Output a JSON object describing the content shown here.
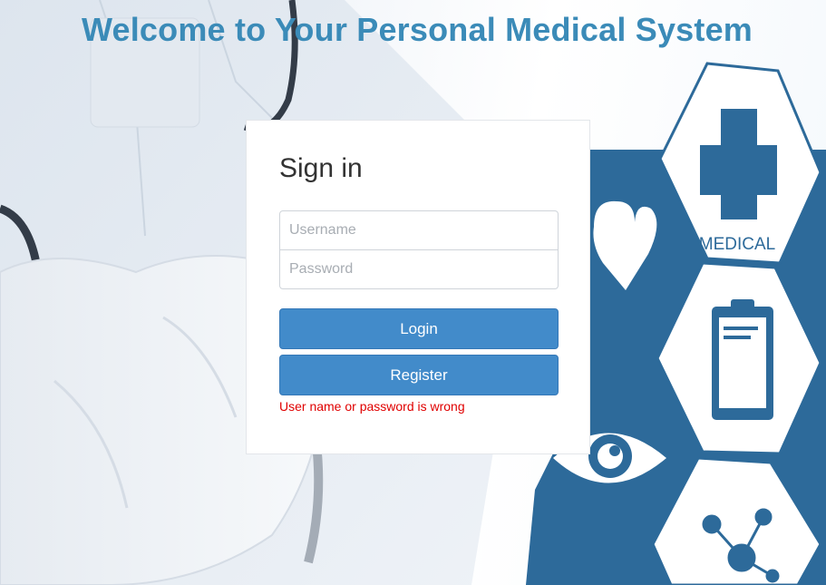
{
  "header": {
    "title": "Welcome to Your Personal Medical System"
  },
  "signin": {
    "title": "Sign in",
    "username_placeholder": "Username",
    "password_placeholder": "Password",
    "login_label": "Login",
    "register_label": "Register",
    "error_message": "User name or password is wrong"
  },
  "background": {
    "medical_label": "MEDICAL",
    "icons": [
      "stethoscope-icon",
      "medical-cross-icon",
      "clipboard-icon",
      "heart-icon",
      "eye-icon",
      "molecule-icon"
    ]
  },
  "colors": {
    "title": "#3b8bb8",
    "button": "#428bca",
    "hex_blue": "#2d6a9a",
    "error": "#e00000"
  }
}
